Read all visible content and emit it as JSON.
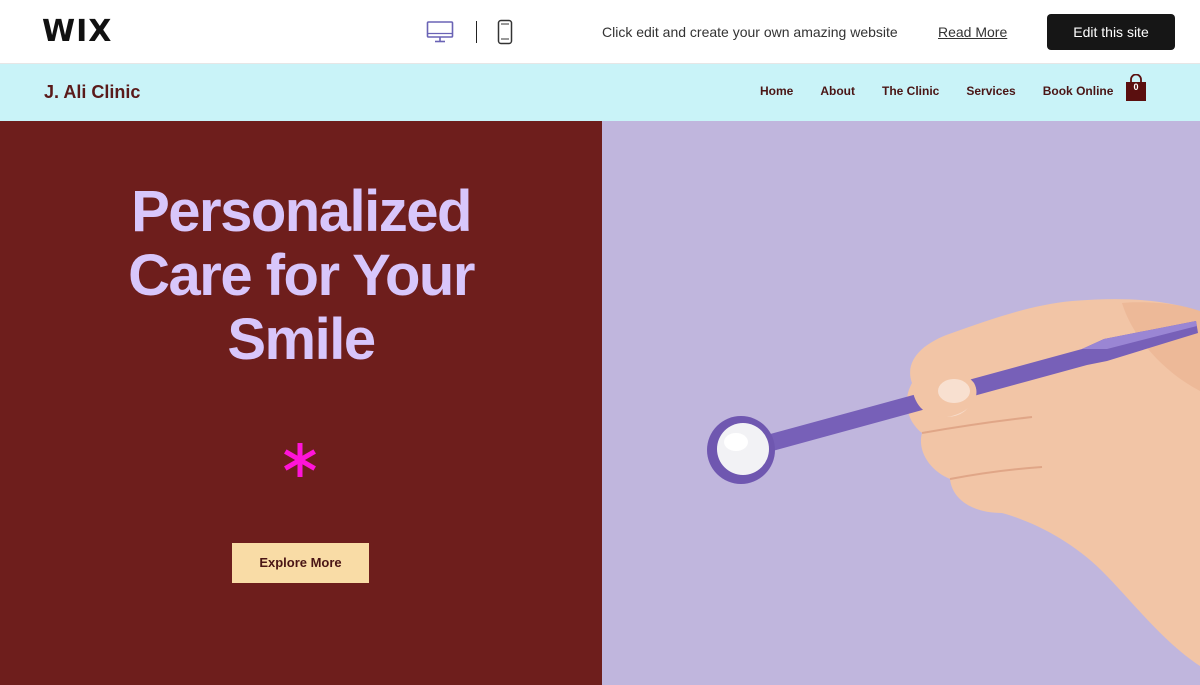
{
  "wix_bar": {
    "logo": "WIX",
    "promo_text": "Click edit and create your own amazing website",
    "read_more": "Read More",
    "edit_button": "Edit this site",
    "device_icons": [
      "desktop-icon",
      "mobile-icon"
    ],
    "active_device": "desktop"
  },
  "site": {
    "title": "J. Ali Clinic",
    "nav": [
      "Home",
      "About",
      "The Clinic",
      "Services",
      "Book Online"
    ],
    "cart_count": "0"
  },
  "hero": {
    "title_lines": [
      "Personalized",
      "Care for Your",
      "Smile"
    ],
    "explore_button": "Explore More",
    "decorative_icon": "asterisk-icon",
    "image_subject": "hand-holding-dental-mirror"
  },
  "colors": {
    "wix_button_bg": "#161616",
    "header_bg": "#c9f3f8",
    "hero_left_bg": "#6e1e1c",
    "hero_right_bg": "#c0b6dd",
    "hero_title": "#d8c6fb",
    "asterisk": "#ff14d8",
    "explore_bg": "#f9dca6",
    "brand_text": "#5a1a1a",
    "device_icon_active": "#6a63b5"
  }
}
